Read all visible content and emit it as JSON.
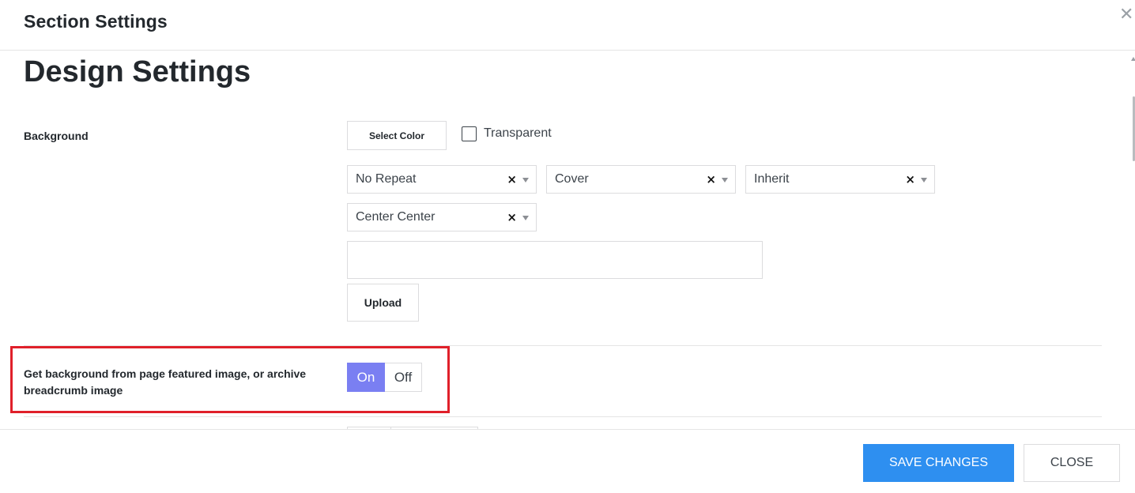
{
  "modal": {
    "title": "Section Settings",
    "close_icon": "close-icon"
  },
  "section": {
    "title": "Design Settings"
  },
  "background": {
    "label": "Background",
    "select_color_label": "Select Color",
    "transparent_label": "Transparent",
    "transparent_checked": false,
    "repeat_value": "No Repeat",
    "size_value": "Cover",
    "attachment_value": "Inherit",
    "position_value": "Center Center",
    "image_url_value": "",
    "upload_label": "Upload",
    "clear_glyph": "×"
  },
  "featured": {
    "label": "Get background from page featured image, or archive breadcrumb image",
    "on_label": "On",
    "off_label": "Off",
    "selected": "On",
    "highlight_color": "#e0202a"
  },
  "footer": {
    "save_label": "SAVE CHANGES",
    "close_label": "CLOSE"
  },
  "colors": {
    "accent_blue": "#2e8ff0",
    "toggle_on": "#7a7ff2"
  }
}
